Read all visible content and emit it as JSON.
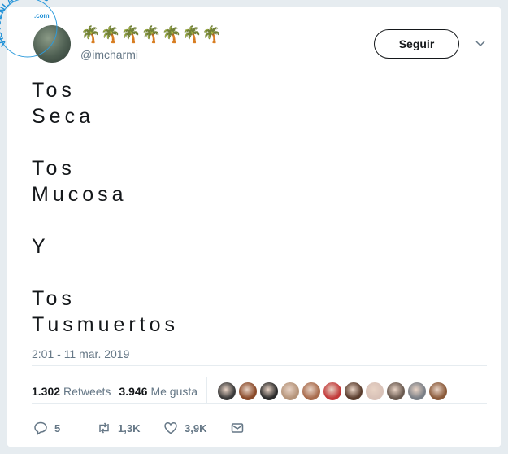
{
  "watermark": {
    "main_text": "VISTOENLASREDES",
    "sub_text": ".com"
  },
  "header": {
    "display_name": "🌴🌴🌴🌴🌴🌴🌴",
    "handle": "@imcharmi",
    "follow_label": "Seguir"
  },
  "tweet": {
    "text": "Tos\nSeca\n\nTos\nMucosa\n\nY\n\nTos\nTusmuertos",
    "timestamp": "2:01 - 11 mar. 2019"
  },
  "stats": {
    "retweets_count": "1.302",
    "retweets_label": "Retweets",
    "likes_count": "3.946",
    "likes_label": "Me gusta"
  },
  "likers": {
    "colors": [
      "#3a3a3a",
      "#8a4a2a",
      "#2b2b2b",
      "#b5947a",
      "#a86b4c",
      "#c23a3a",
      "#5a3d2e",
      "#d9c2b8",
      "#6a5a50",
      "#7a7f86",
      "#8a5a3a"
    ]
  },
  "actions": {
    "replies": "5",
    "retweets": "1,3K",
    "likes": "3,9K"
  }
}
